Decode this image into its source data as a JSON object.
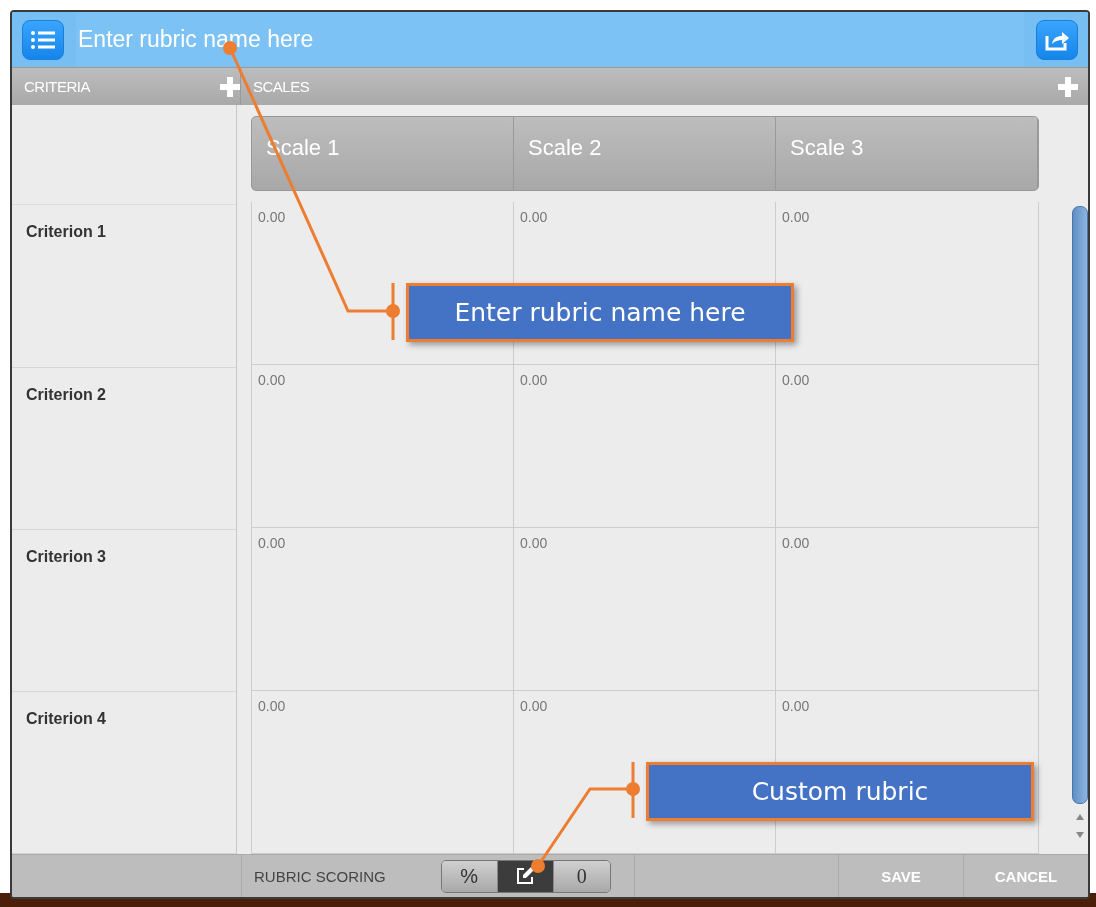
{
  "header": {
    "placeholder": "Enter rubric name here"
  },
  "criteria_header": "CRITERIA",
  "scales_header": "SCALES",
  "scales": [
    "Scale 1",
    "Scale 2",
    "Scale 3"
  ],
  "criteria": [
    {
      "name": "Criterion 1",
      "scores": [
        "0.00",
        "0.00",
        "0.00"
      ]
    },
    {
      "name": "Criterion 2",
      "scores": [
        "0.00",
        "0.00",
        "0.00"
      ]
    },
    {
      "name": "Criterion 3",
      "scores": [
        "0.00",
        "0.00",
        "0.00"
      ]
    },
    {
      "name": "Criterion 4",
      "scores": [
        "0.00",
        "0.00",
        "0.00"
      ]
    }
  ],
  "footer": {
    "scoring_label": "RUBRIC SCORING",
    "scoring_options": [
      {
        "kind": "text",
        "label": "%",
        "selected": false
      },
      {
        "kind": "edit",
        "selected": true
      },
      {
        "kind": "text",
        "label": "0",
        "selected": false
      }
    ],
    "buttons": [
      "SAVE",
      "CANCEL"
    ]
  },
  "callouts": [
    {
      "text": "Enter rubric name here"
    },
    {
      "text": "Custom rubric"
    }
  ]
}
